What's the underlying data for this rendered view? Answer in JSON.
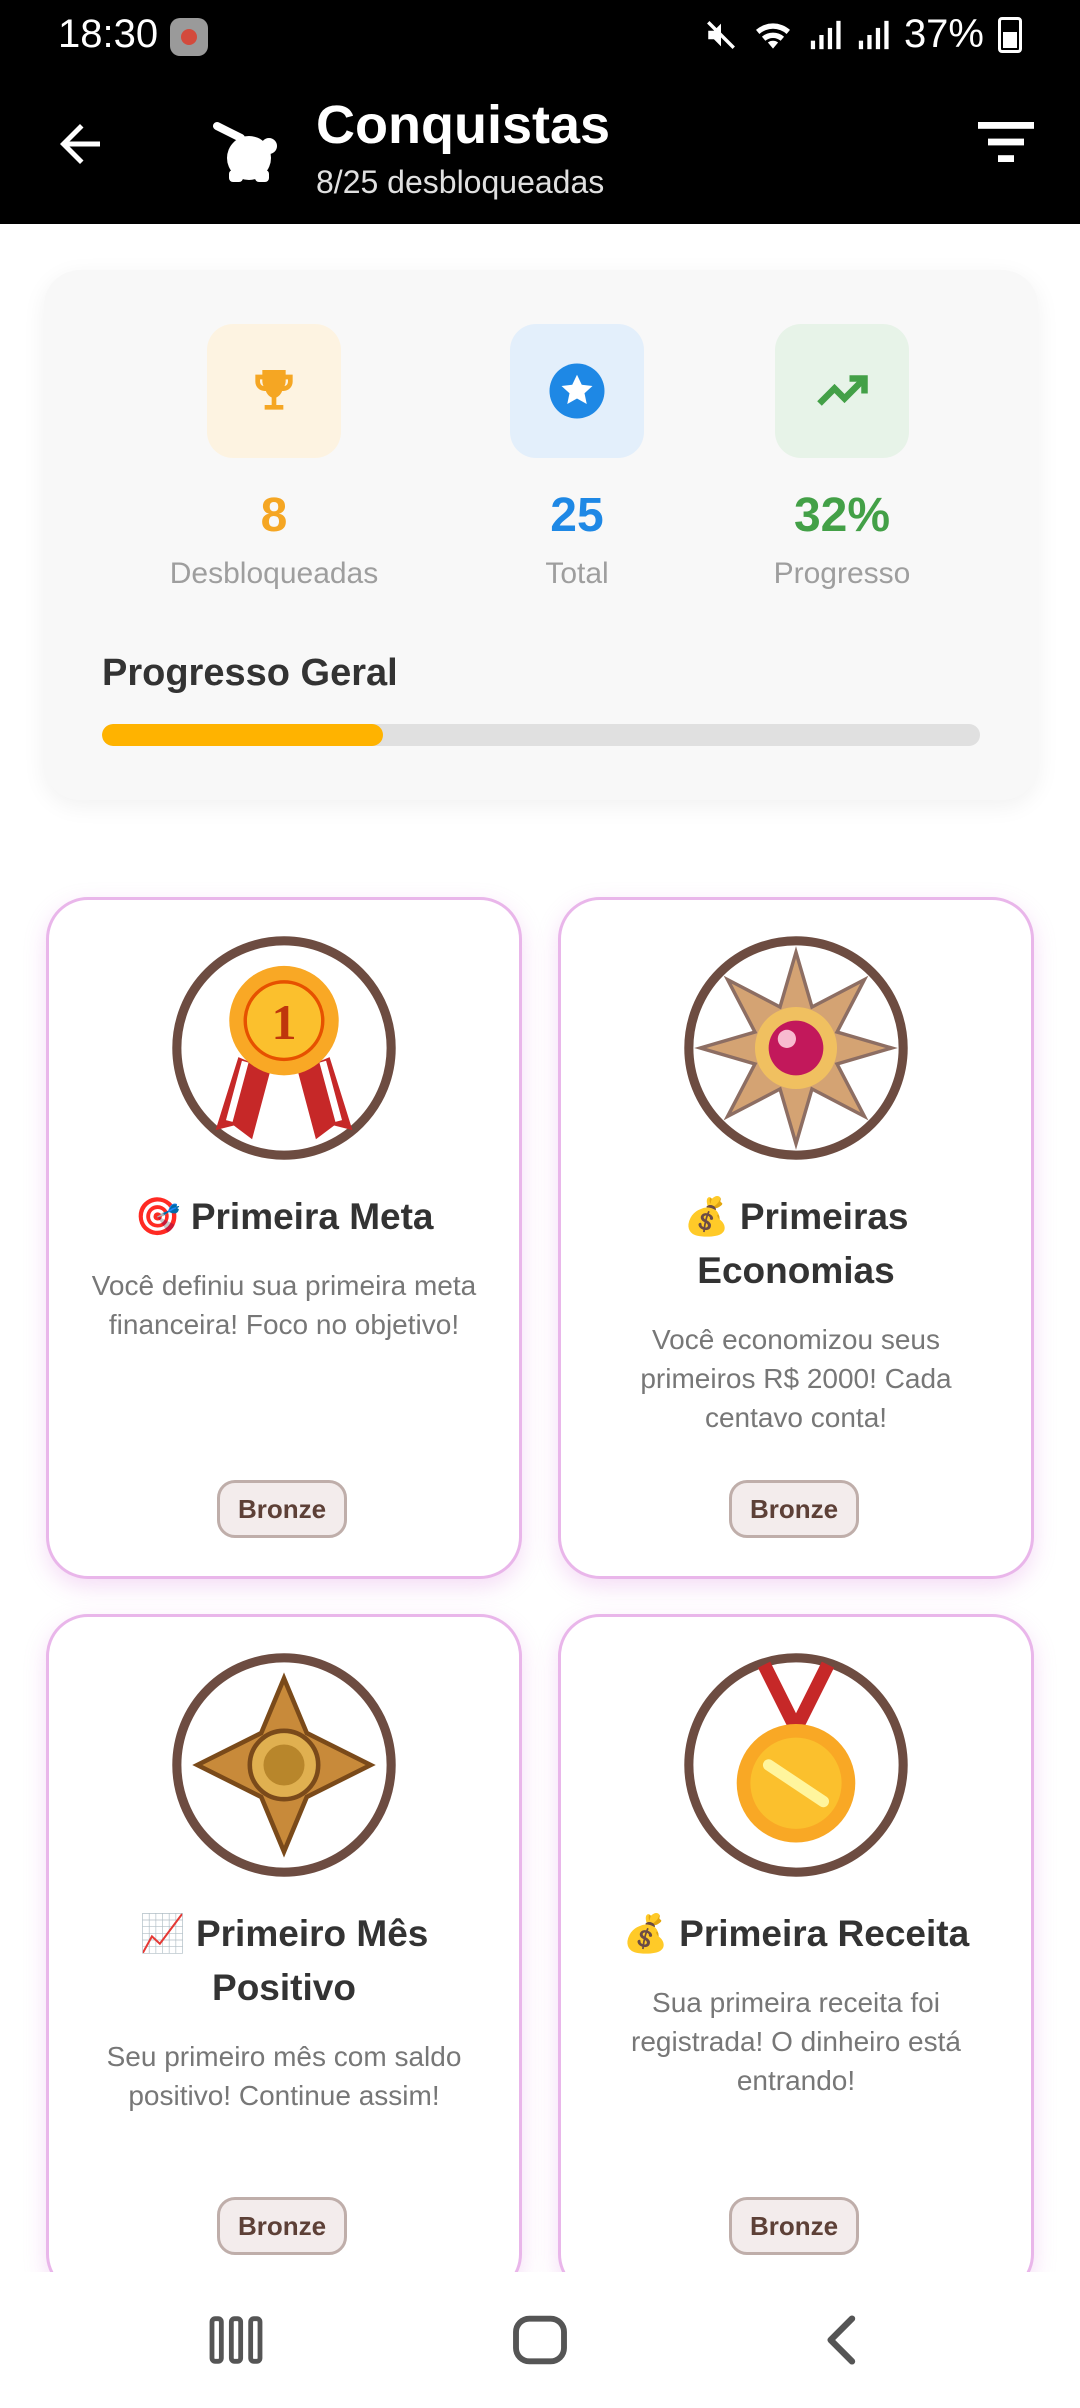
{
  "status_bar": {
    "time": "18:30",
    "battery": "37%"
  },
  "app_bar": {
    "title": "Conquistas",
    "subtitle": "8/25 desbloqueadas"
  },
  "summary": {
    "stats": [
      {
        "value": "8",
        "label": "Desbloqueadas",
        "color": "#f5a623",
        "icon": "trophy-icon"
      },
      {
        "value": "25",
        "label": "Total",
        "color": "#1e88e5",
        "icon": "star-badge-icon"
      },
      {
        "value": "32%",
        "label": "Progresso",
        "color": "#43a047",
        "icon": "trending-up-icon"
      }
    ],
    "progress_title": "Progresso Geral",
    "progress_fraction": 0.32
  },
  "achievements": [
    {
      "emoji": "🎯",
      "title": "Primeira Meta",
      "description": "Você definiu sua primeira meta financeira! Foco no objetivo!",
      "tier": "Bronze",
      "medal": "ribbon-medal-icon"
    },
    {
      "emoji": "💰",
      "title": "Primeiras Economias",
      "description": "Você economizou seus primeiros R$ 2000! Cada centavo conta!",
      "tier": "Bronze",
      "medal": "star-medal-icon"
    },
    {
      "emoji": "📈",
      "title": "Primeiro Mês Positivo",
      "description": "Seu primeiro mês com saldo positivo! Continue assim!",
      "tier": "Bronze",
      "medal": "cross-medal-icon"
    },
    {
      "emoji": "💰",
      "title": "Primeira Receita",
      "description": "Sua primeira receita foi registrada! O dinheiro está entrando!",
      "tier": "Bronze",
      "medal": "gold-medal-icon"
    }
  ]
}
